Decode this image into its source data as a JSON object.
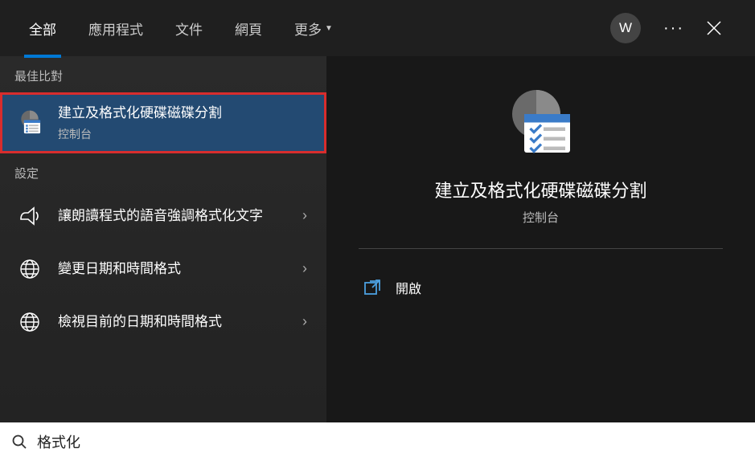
{
  "header": {
    "tabs": [
      "全部",
      "應用程式",
      "文件",
      "網頁",
      "更多"
    ],
    "avatar_initial": "W"
  },
  "sections": {
    "best_match": "最佳比對",
    "settings": "設定"
  },
  "results": {
    "best": {
      "title": "建立及格式化硬碟磁碟分割",
      "subtitle": "控制台"
    },
    "settings_items": [
      {
        "title": "讓朗讀程式的語音強調格式化文字"
      },
      {
        "title": "變更日期和時間格式"
      },
      {
        "title": "檢視目前的日期和時間格式"
      }
    ]
  },
  "preview": {
    "title": "建立及格式化硬碟磁碟分割",
    "subtitle": "控制台",
    "actions": {
      "open": "開啟"
    }
  },
  "search": {
    "value": "格式化"
  }
}
